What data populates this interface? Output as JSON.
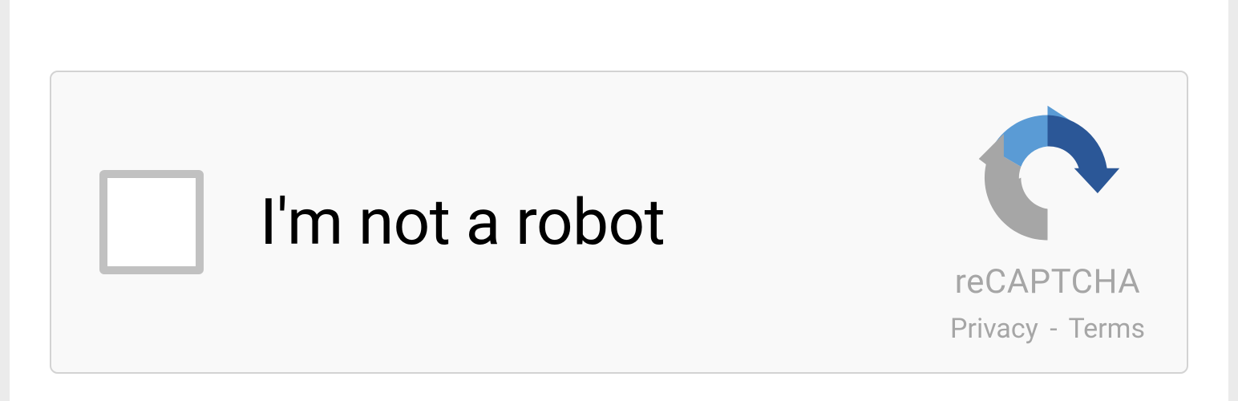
{
  "recaptcha": {
    "checkbox_label": "I'm not a robot",
    "brand_name": "reCAPTCHA",
    "privacy_label": "Privacy",
    "separator": "-",
    "terms_label": "Terms"
  }
}
